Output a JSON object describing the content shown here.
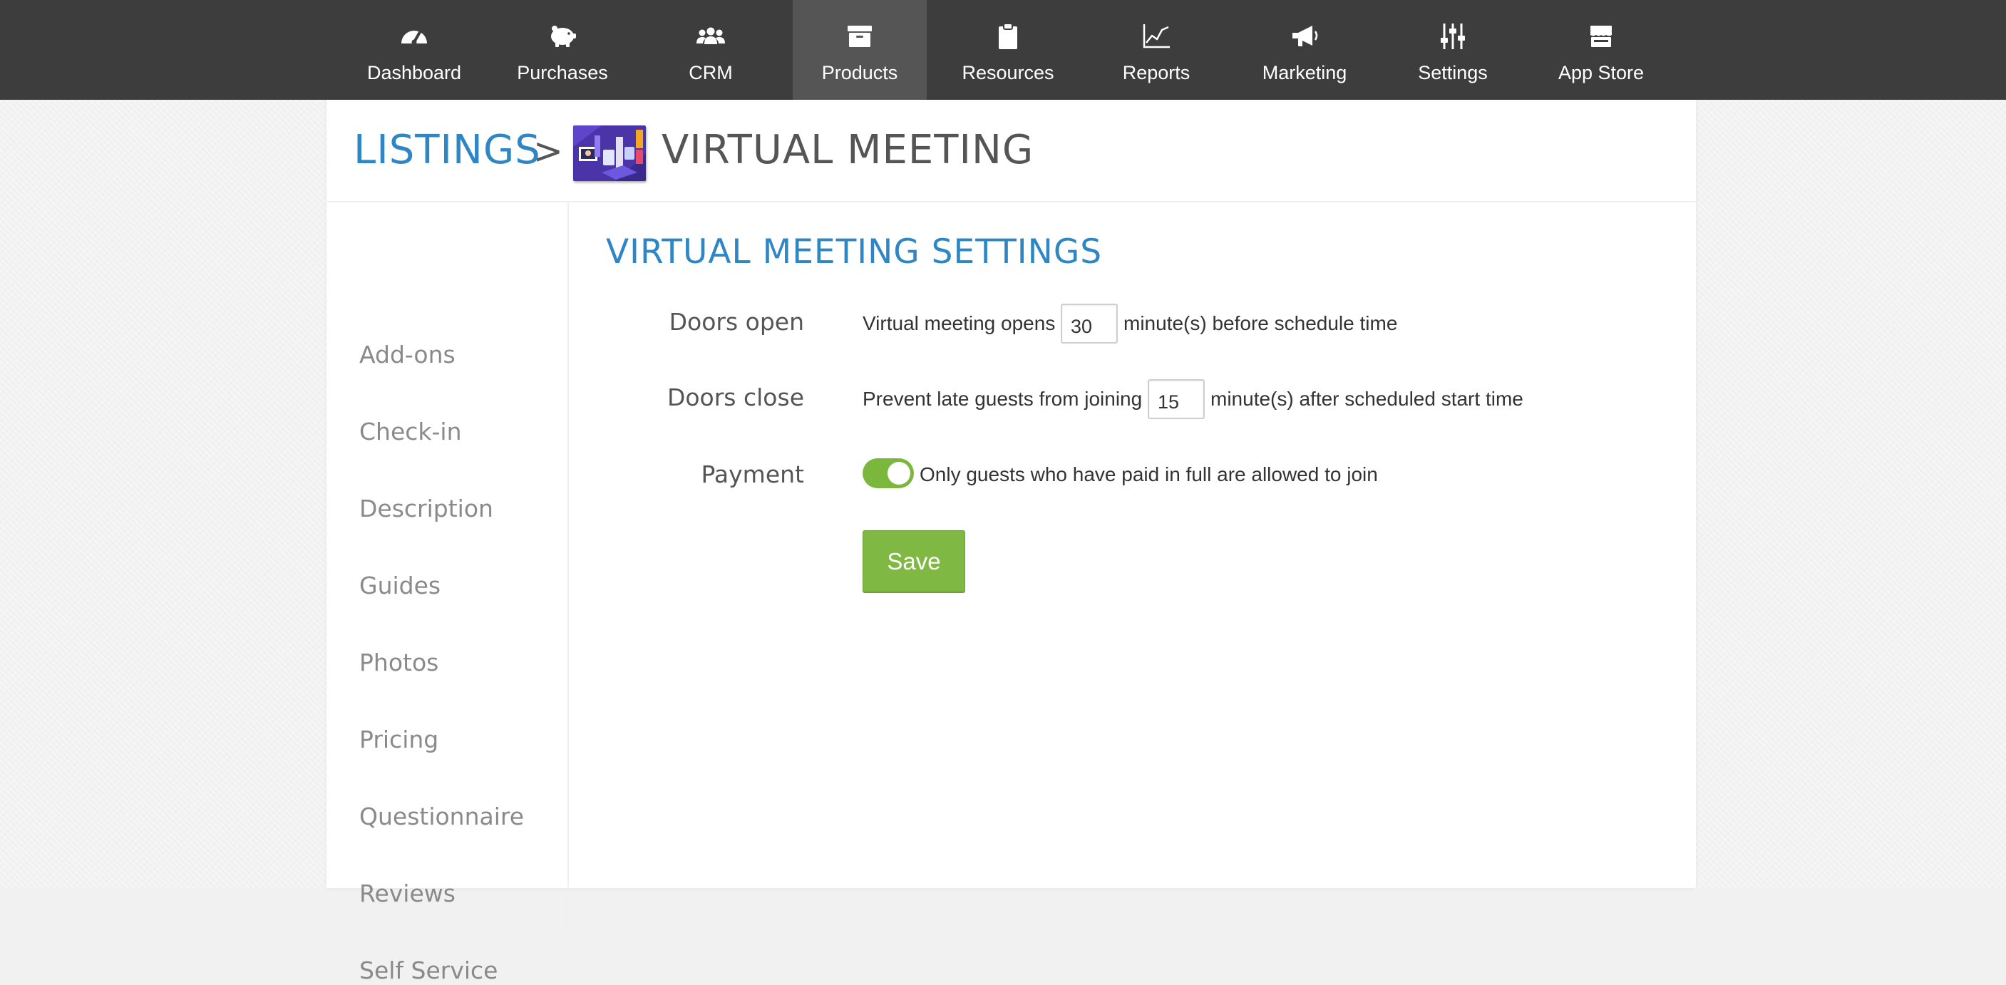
{
  "nav": {
    "items": [
      {
        "label": "Dashboard",
        "icon": "dashboard-gauge-icon"
      },
      {
        "label": "Purchases",
        "icon": "piggy-bank-icon"
      },
      {
        "label": "CRM",
        "icon": "users-group-icon"
      },
      {
        "label": "Products",
        "icon": "archive-box-icon",
        "active": true
      },
      {
        "label": "Resources",
        "icon": "clipboard-icon"
      },
      {
        "label": "Reports",
        "icon": "line-chart-icon"
      },
      {
        "label": "Marketing",
        "icon": "megaphone-icon"
      },
      {
        "label": "Settings",
        "icon": "sliders-icon"
      },
      {
        "label": "App Store",
        "icon": "store-icon"
      }
    ]
  },
  "header": {
    "breadcrumb_link": "LISTINGS",
    "separator": ">",
    "title": "VIRTUAL MEETING"
  },
  "sidebar": {
    "items": [
      {
        "label": "Add-ons"
      },
      {
        "label": "Check-in"
      },
      {
        "label": "Description"
      },
      {
        "label": "Guides"
      },
      {
        "label": "Photos"
      },
      {
        "label": "Pricing"
      },
      {
        "label": "Questionnaire"
      },
      {
        "label": "Reviews"
      },
      {
        "label": "Self Service"
      }
    ]
  },
  "settings": {
    "title": "VIRTUAL MEETING SETTINGS",
    "doors_open": {
      "label": "Doors open",
      "prefix": "Virtual meeting opens",
      "value": "30",
      "suffix": "minute(s) before schedule time"
    },
    "doors_close": {
      "label": "Doors close",
      "prefix": "Prevent late guests from joining",
      "value": "15",
      "suffix": "minute(s) after scheduled start time"
    },
    "payment": {
      "label": "Payment",
      "toggle_on": true,
      "text": "Only guests who have paid in full are allowed to join"
    },
    "save_label": "Save"
  },
  "colors": {
    "accent_blue": "#2f86c5",
    "nav_bg": "#3d3d3d",
    "nav_active": "#555555",
    "toggle_green": "#7bb73c",
    "save_green": "#7fb843"
  }
}
